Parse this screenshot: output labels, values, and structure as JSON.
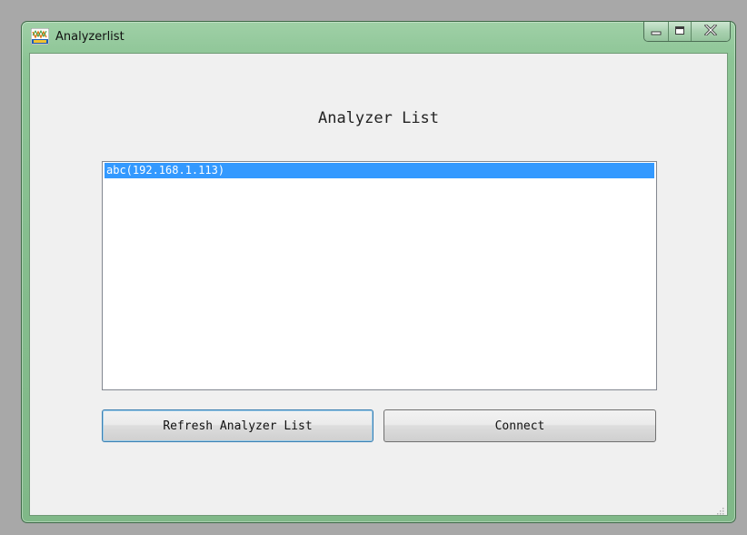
{
  "window": {
    "title": "Analyzerlist",
    "app_icon": "analyzer-app-icon",
    "controls": {
      "minimize_icon": "minimize-icon",
      "maximize_icon": "maximize-icon",
      "close_icon": "close-icon"
    }
  },
  "main": {
    "list_title": "Analyzer List",
    "analyzers": [
      {
        "label": "abc(192.168.1.113)",
        "selected": true
      }
    ],
    "refresh_label": "Refresh Analyzer List",
    "connect_label": "Connect"
  },
  "colors": {
    "titlebar": "#8cc495",
    "selection": "#3399ff",
    "client_bg": "#f0f0f0"
  }
}
